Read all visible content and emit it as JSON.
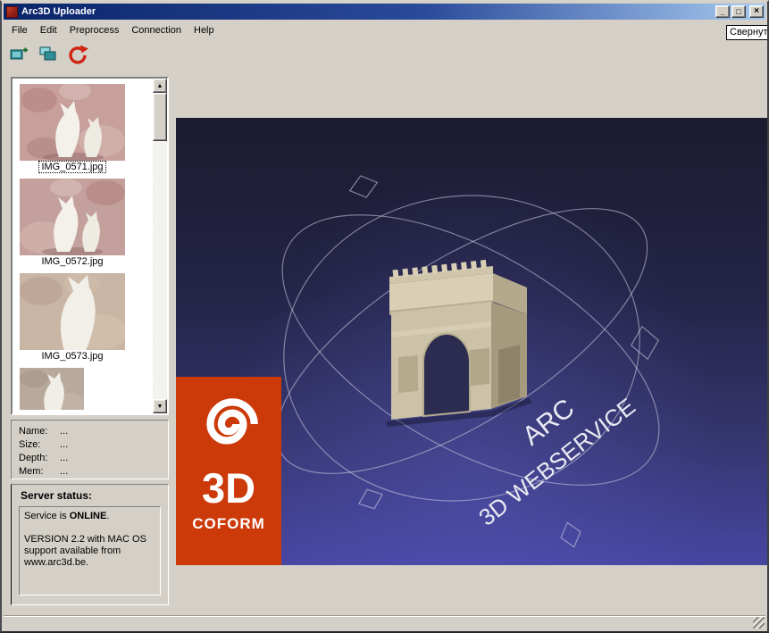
{
  "window": {
    "title": "Arc3D Uploader",
    "controls": {
      "minimize": "_",
      "maximize": "□",
      "close": "×"
    }
  },
  "menu": {
    "items": [
      "File",
      "Edit",
      "Preprocess",
      "Connection",
      "Help"
    ]
  },
  "tooltip": {
    "text": "Свернуть"
  },
  "icons": {
    "scroll_up": "▲",
    "scroll_down": "▼",
    "toolbar": [
      "add-image-icon",
      "image-stack-icon",
      "upload-refresh-icon"
    ],
    "logo_spiral": "spiral-icon"
  },
  "image_list": {
    "items": [
      {
        "label": "IMG_0571.jpg",
        "selected": true
      },
      {
        "label": "IMG_0572.jpg",
        "selected": false
      },
      {
        "label": "IMG_0573.jpg",
        "selected": false
      }
    ]
  },
  "info_panel": {
    "rows": [
      {
        "label": "Name:",
        "value": "..."
      },
      {
        "label": "Size:",
        "value": "..."
      },
      {
        "label": "Depth:",
        "value": "..."
      },
      {
        "label": "Mem:",
        "value": "..."
      }
    ]
  },
  "server": {
    "title": "Server status:",
    "status_prefix": "Service is ",
    "status_word": "ONLINE",
    "status_suffix": ".",
    "version": "VERSION 2.2 with MAC OS support available from www.arc3d.be."
  },
  "viewer": {
    "label_arc": "ARC",
    "label_webservice": "3D WEBSERVICE"
  },
  "logo": {
    "big": "3D",
    "small": "COFORM"
  },
  "colors": {
    "logo_orange": "#cc3a0a",
    "titlebar_left": "#0a246a",
    "titlebar_right": "#a6caf0",
    "viewer_top": "#1b1b30",
    "viewer_bottom": "#4646a2",
    "chrome_gray": "#d4d0c8"
  }
}
